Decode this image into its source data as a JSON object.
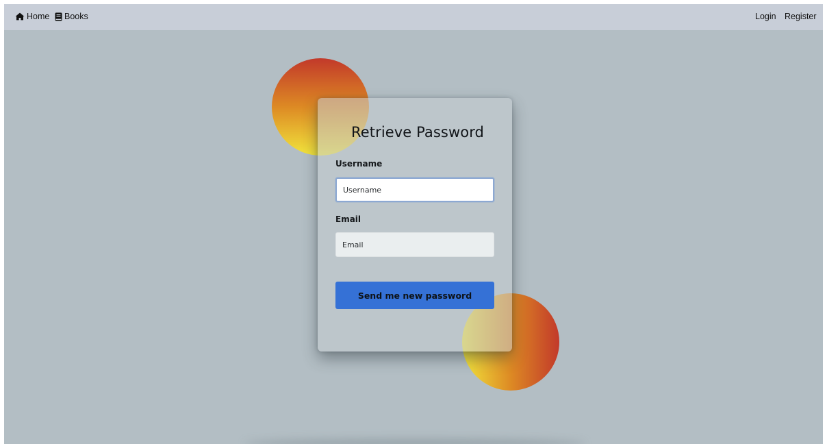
{
  "navbar": {
    "home": {
      "label": "Home",
      "icon": "home-icon"
    },
    "books": {
      "label": "Books",
      "icon": "book-icon"
    },
    "login": {
      "label": "Login"
    },
    "register": {
      "label": "Register"
    }
  },
  "form": {
    "title": "Retrieve Password",
    "username": {
      "label": "Username",
      "placeholder": "Username",
      "value": ""
    },
    "email": {
      "label": "Email",
      "placeholder": "Email",
      "value": ""
    },
    "submit_label": "Send me new password"
  },
  "colors": {
    "page_background": "#b3bec4",
    "navbar_background": "#c8ced8",
    "button": "#3571d6",
    "gradient_red": "#c2392a",
    "gradient_orange": "#dd8a24",
    "gradient_yellow": "#f1e43c"
  }
}
